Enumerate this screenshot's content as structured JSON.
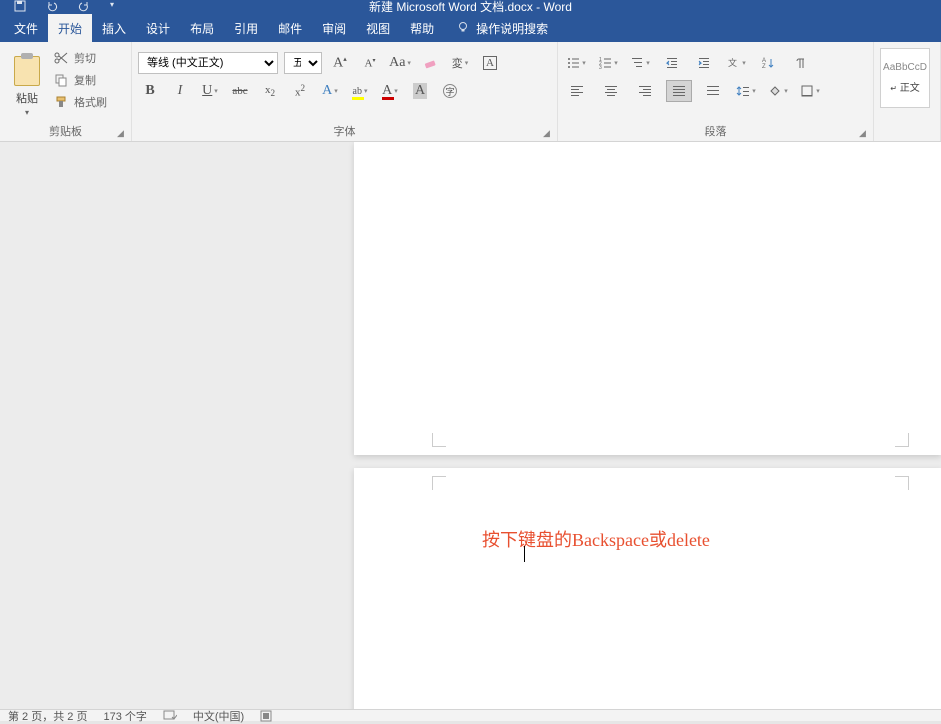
{
  "titlebar": {
    "document_title": "新建 Microsoft Word 文档.docx  -  Word"
  },
  "menu": {
    "file": "文件",
    "home": "开始",
    "insert": "插入",
    "design": "设计",
    "layout": "布局",
    "references": "引用",
    "mailings": "邮件",
    "review": "审阅",
    "view": "视图",
    "help": "帮助",
    "tell_me": "操作说明搜索"
  },
  "ribbon": {
    "clipboard": {
      "label": "剪贴板",
      "paste": "粘贴",
      "cut": "剪切",
      "copy": "复制",
      "format_painter": "格式刷"
    },
    "font": {
      "label": "字体",
      "font_name": "等线 (中文正文)",
      "font_size": "五号"
    },
    "paragraph": {
      "label": "段落"
    },
    "styles": {
      "preview_text": "AaBbCcD",
      "normal": "正文"
    }
  },
  "document": {
    "annotation": "按下键盘的Backspace或delete"
  },
  "statusbar": {
    "page_info": "第 2 页，共 2 页",
    "word_count": "173 个字",
    "language": "中文(中国)"
  }
}
